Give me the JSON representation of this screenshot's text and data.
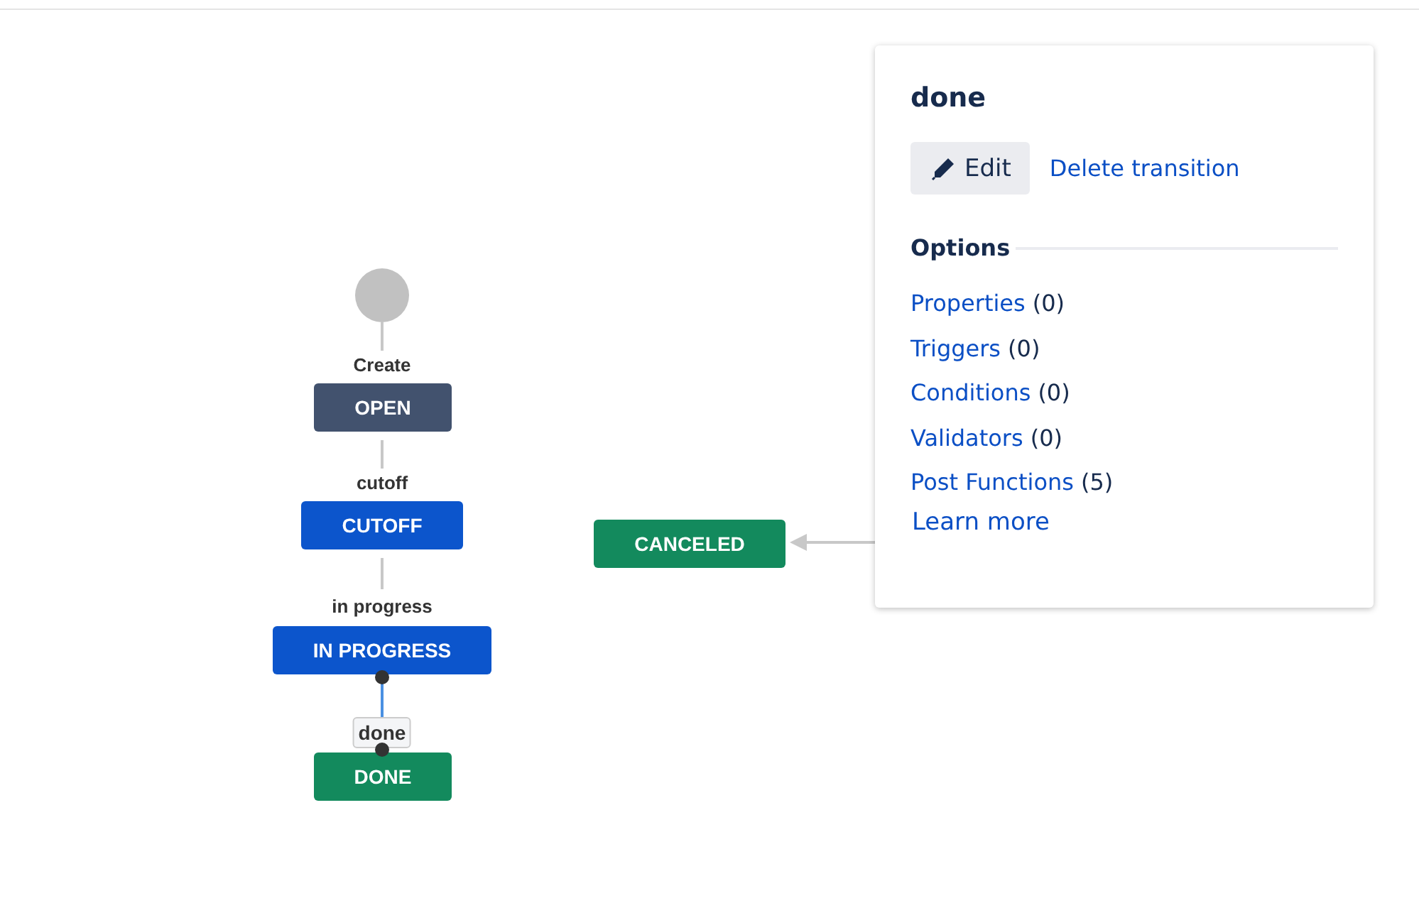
{
  "diagram": {
    "statuses": [
      {
        "name": "OPEN",
        "color": "#42526e"
      },
      {
        "name": "CUTOFF",
        "color": "#0c55cc"
      },
      {
        "name": "IN PROGRESS",
        "color": "#0c55cc"
      },
      {
        "name": "DONE",
        "color": "#138a5d"
      },
      {
        "name": "CANCELED",
        "color": "#138a5d"
      }
    ],
    "transitions": [
      {
        "label": "Create",
        "selected": false
      },
      {
        "label": "cutoff",
        "selected": false
      },
      {
        "label": "in progress",
        "selected": false
      },
      {
        "label": "done",
        "selected": true
      }
    ]
  },
  "panel": {
    "title": "done",
    "edit_button": "Edit",
    "delete_link": "Delete transition",
    "options_heading": "Options",
    "options": [
      {
        "label": "Properties",
        "count": "(0)"
      },
      {
        "label": "Triggers",
        "count": "(0)"
      },
      {
        "label": "Conditions",
        "count": "(0)"
      },
      {
        "label": "Validators",
        "count": "(0)"
      },
      {
        "label": "Post Functions",
        "count": "(5)"
      }
    ],
    "learn_more": "Learn more"
  }
}
